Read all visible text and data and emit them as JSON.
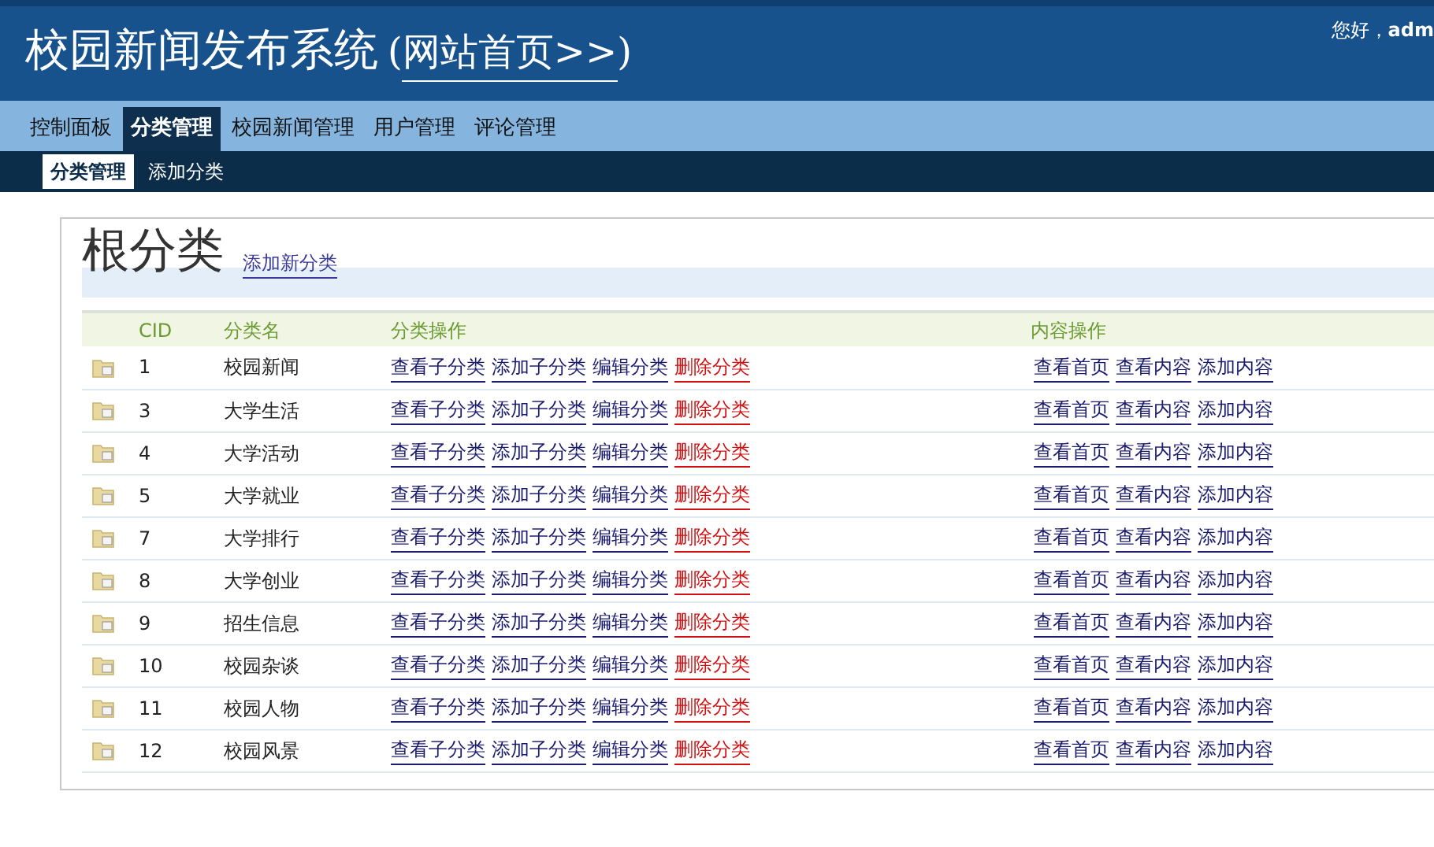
{
  "header": {
    "title": "校园新闻发布系统",
    "open_paren": "(",
    "home_link": "网站首页>>",
    "close_paren": ")",
    "greeting": "您好，",
    "user": "adm"
  },
  "nav": [
    {
      "label": "控制面板",
      "selected": false
    },
    {
      "label": "分类管理",
      "selected": true
    },
    {
      "label": "校园新闻管理",
      "selected": false
    },
    {
      "label": "用户管理",
      "selected": false
    },
    {
      "label": "评论管理",
      "selected": false
    }
  ],
  "subnav": [
    {
      "label": "分类管理",
      "selected": true
    },
    {
      "label": "添加分类",
      "selected": false
    }
  ],
  "panel": {
    "title": "根分类",
    "add_link": "添加新分类"
  },
  "table": {
    "columns": [
      "CID",
      "分类名",
      "分类操作",
      "内容操作"
    ],
    "rows": [
      {
        "cid": "1",
        "name": "校园新闻",
        "category_actions": [
          {
            "label": "查看子分类",
            "kind": "normal"
          },
          {
            "label": "添加子分类",
            "kind": "normal"
          },
          {
            "label": "编辑分类",
            "kind": "normal"
          },
          {
            "label": "删除分类",
            "kind": "danger"
          }
        ],
        "content_actions": [
          "查看首页",
          "查看内容",
          "添加内容"
        ]
      },
      {
        "cid": "3",
        "name": "大学生活",
        "category_actions": [
          {
            "label": "查看子分类",
            "kind": "normal"
          },
          {
            "label": "添加子分类",
            "kind": "normal"
          },
          {
            "label": "编辑分类",
            "kind": "normal"
          },
          {
            "label": "删除分类",
            "kind": "danger"
          }
        ],
        "content_actions": [
          "查看首页",
          "查看内容",
          "添加内容"
        ]
      },
      {
        "cid": "4",
        "name": "大学活动",
        "category_actions": [
          {
            "label": "查看子分类",
            "kind": "normal"
          },
          {
            "label": "添加子分类",
            "kind": "normal"
          },
          {
            "label": "编辑分类",
            "kind": "normal"
          },
          {
            "label": "删除分类",
            "kind": "danger"
          }
        ],
        "content_actions": [
          "查看首页",
          "查看内容",
          "添加内容"
        ]
      },
      {
        "cid": "5",
        "name": "大学就业",
        "category_actions": [
          {
            "label": "查看子分类",
            "kind": "normal"
          },
          {
            "label": "添加子分类",
            "kind": "normal"
          },
          {
            "label": "编辑分类",
            "kind": "normal"
          },
          {
            "label": "删除分类",
            "kind": "danger"
          }
        ],
        "content_actions": [
          "查看首页",
          "查看内容",
          "添加内容"
        ]
      },
      {
        "cid": "7",
        "name": "大学排行",
        "category_actions": [
          {
            "label": "查看子分类",
            "kind": "normal"
          },
          {
            "label": "添加子分类",
            "kind": "normal"
          },
          {
            "label": "编辑分类",
            "kind": "normal"
          },
          {
            "label": "删除分类",
            "kind": "danger"
          }
        ],
        "content_actions": [
          "查看首页",
          "查看内容",
          "添加内容"
        ]
      },
      {
        "cid": "8",
        "name": "大学创业",
        "category_actions": [
          {
            "label": "查看子分类",
            "kind": "normal"
          },
          {
            "label": "添加子分类",
            "kind": "normal"
          },
          {
            "label": "编辑分类",
            "kind": "normal"
          },
          {
            "label": "删除分类",
            "kind": "danger"
          }
        ],
        "content_actions": [
          "查看首页",
          "查看内容",
          "添加内容"
        ]
      },
      {
        "cid": "9",
        "name": "招生信息",
        "category_actions": [
          {
            "label": "查看子分类",
            "kind": "normal"
          },
          {
            "label": "添加子分类",
            "kind": "normal"
          },
          {
            "label": "编辑分类",
            "kind": "normal"
          },
          {
            "label": "删除分类",
            "kind": "danger"
          }
        ],
        "content_actions": [
          "查看首页",
          "查看内容",
          "添加内容"
        ]
      },
      {
        "cid": "10",
        "name": "校园杂谈",
        "category_actions": [
          {
            "label": "查看子分类",
            "kind": "normal"
          },
          {
            "label": "添加子分类",
            "kind": "normal"
          },
          {
            "label": "编辑分类",
            "kind": "normal"
          },
          {
            "label": "删除分类",
            "kind": "danger"
          }
        ],
        "content_actions": [
          "查看首页",
          "查看内容",
          "添加内容"
        ]
      },
      {
        "cid": "11",
        "name": "校园人物",
        "category_actions": [
          {
            "label": "查看子分类",
            "kind": "normal"
          },
          {
            "label": "添加子分类",
            "kind": "normal"
          },
          {
            "label": "编辑分类",
            "kind": "normal"
          },
          {
            "label": "删除分类",
            "kind": "danger"
          }
        ],
        "content_actions": [
          "查看首页",
          "查看内容",
          "添加内容"
        ]
      },
      {
        "cid": "12",
        "name": "校园风景",
        "category_actions": [
          {
            "label": "查看子分类",
            "kind": "normal"
          },
          {
            "label": "添加子分类",
            "kind": "normal"
          },
          {
            "label": "编辑分类",
            "kind": "normal"
          },
          {
            "label": "删除分类",
            "kind": "danger"
          }
        ],
        "content_actions": [
          "查看首页",
          "查看内容",
          "添加内容"
        ]
      }
    ]
  }
}
